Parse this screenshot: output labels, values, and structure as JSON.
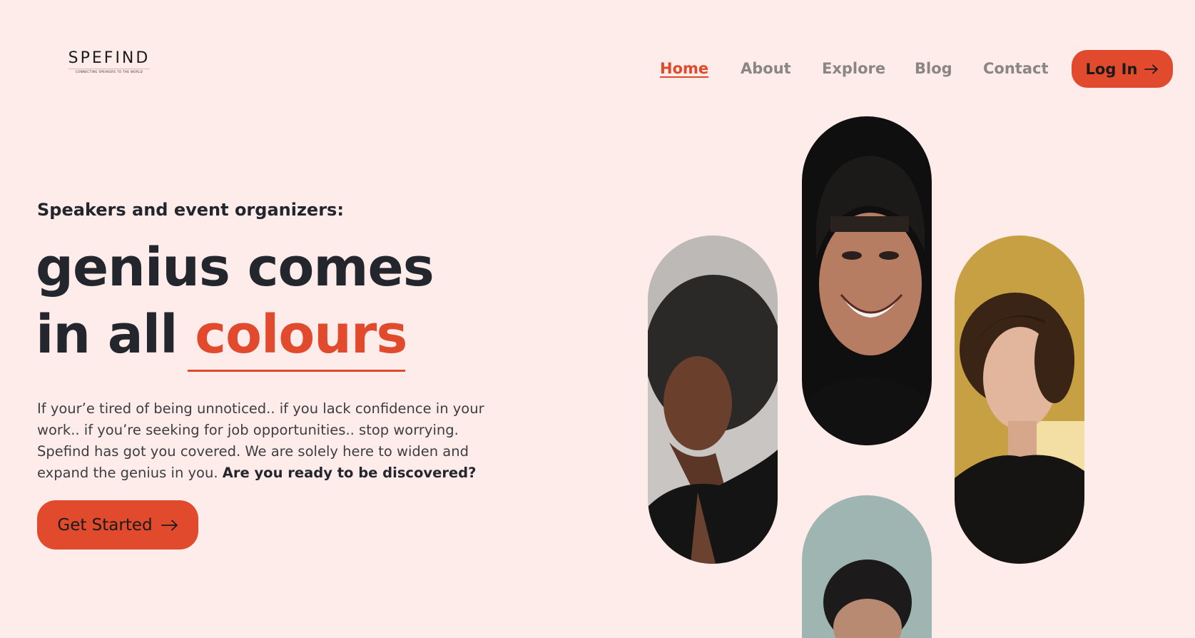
{
  "header": {
    "logo": {
      "name": "SPEFIND",
      "tagline": "CONNECTING SPEAKERS TO THE WORLD"
    },
    "nav": [
      {
        "label": "Home",
        "active": true
      },
      {
        "label": "About",
        "active": false
      },
      {
        "label": "Explore",
        "active": false
      },
      {
        "label": "Blog",
        "active": false
      },
      {
        "label": "Contact",
        "active": false
      }
    ],
    "login_label": "Log In",
    "login_icon": "arrow-right-icon"
  },
  "hero": {
    "eyebrow": "Speakers and event organizers:",
    "headline_line1": "genius comes",
    "headline_line2_prefix": "in all ",
    "headline_accent": "colours",
    "description": "If your’e tired of being unnoticed.. if you lack confidence in your work.. if you’re seeking for job opportunities.. stop worrying. Spefind has got you covered. We are solely here to widen and expand the genius in you. ",
    "description_bold": "Are you ready to be discovered?",
    "cta_label": "Get Started",
    "cta_icon": "arrow-right-icon"
  },
  "gallery": {
    "portraits": [
      {
        "name": "portrait-woman-afro",
        "background": "#c7c4c1"
      },
      {
        "name": "portrait-man-smiling",
        "background": "#111111"
      },
      {
        "name": "portrait-woman-curly",
        "background": "#c9a24a"
      },
      {
        "name": "portrait-man-bottom",
        "background": "#9eb4b0"
      }
    ]
  },
  "colors": {
    "background": "#fdecea",
    "accent": "#e14a2c",
    "text_dark": "#24262d",
    "nav_muted": "#8a8683"
  }
}
